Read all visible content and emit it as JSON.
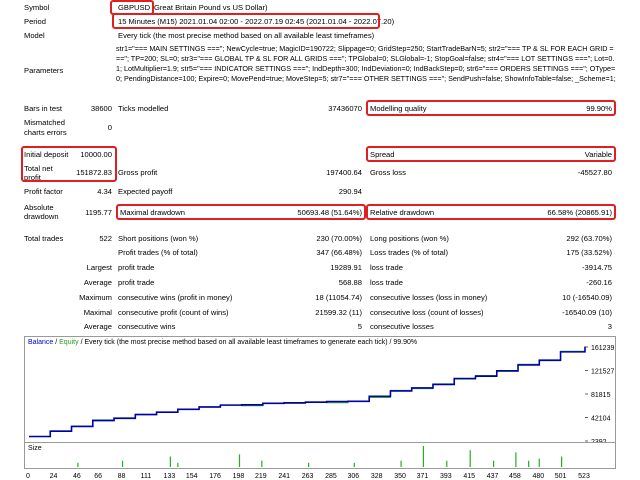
{
  "labels": {
    "symbol": "Symbol",
    "period": "Period",
    "model": "Model",
    "parameters": "Parameters",
    "bars_in_test": "Bars in test",
    "mismatched": "Mismatched charts errors",
    "initial_deposit": "Initial deposit",
    "total_net_profit": "Total net profit",
    "profit_factor": "Profit factor",
    "absolute_drawdown": "Absolute drawdown",
    "total_trades": "Total trades",
    "ticks_modelled": "Ticks modelled",
    "gross_profit": "Gross profit",
    "expected_payoff": "Expected payoff",
    "maximal_drawdown": "Maximal drawdown",
    "short_positions": "Short positions (won %)",
    "profit_trades": "Profit trades (% of total)",
    "largest": "Largest",
    "average": "Average",
    "maximum": "Maximum",
    "maximal": "Maximal",
    "profit_trade": "profit trade",
    "consecutive_wins_money": "consecutive wins (profit in money)",
    "consecutive_profit_count": "consecutive profit (count of wins)",
    "consecutive_wins": "consecutive wins",
    "modelling_quality": "Modelling quality",
    "spread": "Spread",
    "gross_loss": "Gross loss",
    "relative_drawdown": "Relative drawdown",
    "long_positions": "Long positions (won %)",
    "loss_trades": "Loss trades (% of total)",
    "loss_trade": "loss trade",
    "consecutive_losses_money": "consecutive losses (loss in money)",
    "consecutive_loss_count": "consecutive loss (count of losses)",
    "consecutive_losses": "consecutive losses"
  },
  "values": {
    "symbol_code": "GBPUSD",
    "symbol_name": "Great Britain Pound vs US Dollar)",
    "period": "15 Minutes (M15) 2021.01.04 02:00 - 2022.07.19 02:45 (2021.01.04 - 2022.07.20)",
    "model": "Every tick (the most precise method based on all available least timeframes)",
    "parameters": "str1=\"=== MAIN SETTINGS ===\"; NewCycle=true; MagicID=190722; Slippage=0; GridStep=250; StartTradeBarN=5; str2=\"=== TP & SL FOR EACH GRID ===\"; TP=200; SL=0; str3=\"=== GLOBAL TP & SL FOR ALL GRIDS ===\"; TPGlobal=0; SLGlobal=-1; StopGoal=false; str4=\"=== LOT SETTINGS ===\"; Lot=0.1; LotMultiplier=1.9; str5=\"=== INDICATOR SETTINGS ===\"; IndDepth=300; IndDeviation=0; IndBackStep=0; str6=\"=== ORDERS SETTINGS ===\"; OType=0; PendingDistance=100; Expire=0; MovePend=true; MoveStep=5; str7=\"=== OTHER SETTINGS ===\"; SendPush=false; ShowInfoTable=false; _Scheme=1;",
    "bars_in_test": "38600",
    "ticks_modelled": "37436070",
    "modelling_quality": "99.90%",
    "mismatched": "0",
    "initial_deposit": "10000.00",
    "spread": "Variable",
    "total_net_profit": "151872.83",
    "gross_profit": "197400.64",
    "gross_loss": "-45527.80",
    "profit_factor": "4.34",
    "expected_payoff": "290.94",
    "absolute_drawdown": "1195.77",
    "maximal_drawdown": "50693.48 (51.64%)",
    "relative_drawdown": "66.58% (20865.91)",
    "total_trades": "522",
    "short_positions": "230 (70.00%)",
    "long_positions": "292 (63.70%)",
    "profit_trades": "347 (66.48%)",
    "loss_trades": "175 (33.52%)",
    "largest_profit": "19289.91",
    "largest_loss": "-3914.75",
    "average_profit": "568.88",
    "average_loss": "-260.16",
    "max_cons_wins_money": "18 (11054.74)",
    "max_cons_losses_money": "10 (-16540.09)",
    "maximal_cons_profit": "21599.32 (11)",
    "maximal_cons_loss": "-16540.09 (10)",
    "avg_cons_wins": "5",
    "avg_cons_losses": "3"
  },
  "chart": {
    "legend_balance": "Balance",
    "legend_equity": "Equity",
    "legend_rest": "/ Every tick (the most precise method based on all available least timeframes to generate each tick) / 99.90%",
    "volume_label": "Size",
    "colors": {
      "balance": "#0000aa",
      "equity": "#22b022",
      "volume": "#22b022",
      "highlight": "#e02020"
    },
    "chart_data": {
      "type": "line",
      "series": [
        {
          "name": "Balance",
          "x": [
            0,
            20,
            40,
            60,
            80,
            100,
            120,
            140,
            160,
            180,
            200,
            220,
            240,
            260,
            280,
            300,
            320,
            340,
            360,
            380,
            400,
            420,
            440,
            460,
            480,
            500,
            523
          ],
          "y": [
            10000,
            19000,
            27000,
            37000,
            41000,
            47000,
            51000,
            56000,
            60000,
            63000,
            63500,
            66000,
            67000,
            68000,
            69000,
            69500,
            78000,
            87000,
            92000,
            98000,
            108000,
            112000,
            121000,
            131000,
            139000,
            153000,
            161800
          ]
        },
        {
          "name": "Equity",
          "x": [
            0,
            20,
            40,
            60,
            80,
            100,
            120,
            140,
            160,
            180,
            200,
            220,
            240,
            260,
            280,
            300,
            320,
            340,
            360,
            380,
            400,
            420,
            440,
            460,
            480,
            500,
            523
          ],
          "y": [
            9800,
            19500,
            27500,
            38000,
            40000,
            47500,
            50500,
            56500,
            59500,
            63500,
            62000,
            66500,
            66000,
            68500,
            67000,
            70000,
            76000,
            88000,
            91000,
            99000,
            107000,
            113000,
            120000,
            132000,
            138000,
            154000,
            162000
          ]
        }
      ],
      "y_ticks": [
        2392,
        42104,
        81815,
        121527,
        161239
      ],
      "ylim": [
        2392,
        161239
      ],
      "x_ticks": [
        0,
        24,
        46,
        66,
        88,
        111,
        133,
        154,
        176,
        198,
        219,
        241,
        263,
        285,
        306,
        328,
        350,
        371,
        393,
        415,
        437,
        458,
        480,
        501,
        523
      ],
      "volume": {
        "x": [
          46,
          88,
          133,
          140,
          198,
          219,
          263,
          306,
          350,
          371,
          393,
          415,
          437,
          458,
          470,
          480,
          501
        ],
        "y": [
          0.2,
          0.3,
          0.5,
          0.2,
          0.6,
          0.3,
          0.2,
          0.2,
          0.3,
          1.0,
          0.3,
          0.8,
          0.3,
          0.7,
          0.3,
          0.4,
          0.5
        ]
      }
    }
  }
}
